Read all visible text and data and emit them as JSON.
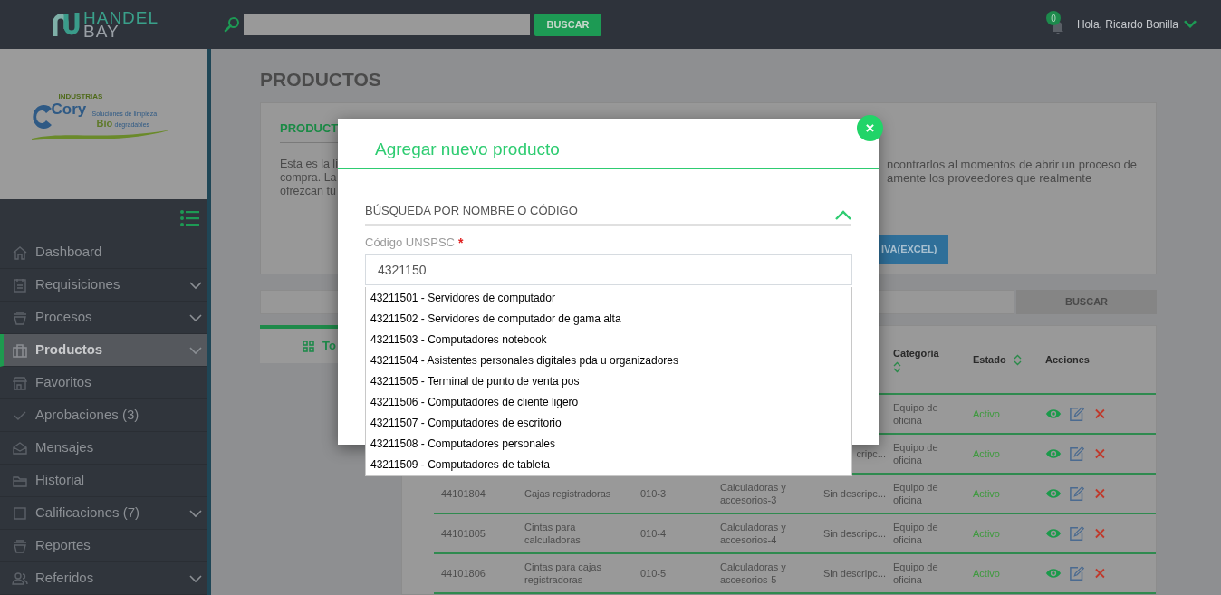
{
  "header": {
    "logo_top": "HANDEL",
    "logo_bottom": "BAY",
    "search_button": "BUSCAR",
    "notification_count": "0",
    "greeting": "Hola, Ricardo Bonilla"
  },
  "sidebar": {
    "company_logo": {
      "small": "INDUSTRIAS",
      "name": "Cory",
      "tagline": "Soluciones de limpieza",
      "bio": "Bio",
      "bio_rest": "degradables"
    },
    "items": [
      {
        "label": "Dashboard",
        "expandable": false,
        "selected": false
      },
      {
        "label": "Requisiciones",
        "expandable": true,
        "selected": false
      },
      {
        "label": "Procesos",
        "expandable": true,
        "selected": false
      },
      {
        "label": "Productos",
        "expandable": true,
        "selected": true
      },
      {
        "label": "Favoritos",
        "expandable": false,
        "selected": false
      },
      {
        "label": "Aprobaciones (3)",
        "expandable": false,
        "selected": false
      },
      {
        "label": "Mensajes",
        "expandable": false,
        "selected": false
      },
      {
        "label": "Historial",
        "expandable": false,
        "selected": false
      },
      {
        "label": "Calificaciones (7)",
        "expandable": true,
        "selected": false
      },
      {
        "label": "Reportes",
        "expandable": false,
        "selected": false
      },
      {
        "label": "Referidos",
        "expandable": true,
        "selected": false
      }
    ]
  },
  "main": {
    "title": "PRODUCTOS",
    "info_card": {
      "title": "PRODUCT",
      "text_left": [
        "Esta es la li",
        "compra. La",
        "ofrezcan tu"
      ],
      "text_right": [
        "ncontrarlos al momentos de abrir un proceso de",
        "amente los proveedores que realmente"
      ],
      "button": "IVA(EXCEL)"
    },
    "search_button": "BUSCAR",
    "tab": {
      "label": "To",
      "selected": true
    },
    "table": {
      "columns": [
        {
          "label": "Categoría",
          "sortable": true
        },
        {
          "label": "Estado",
          "sortable": true
        },
        {
          "label": "Acciones",
          "sortable": false
        }
      ],
      "rows": [
        {
          "category": "Equipo de oficina",
          "status": "Activo"
        },
        {
          "description": "cripc...",
          "category": "Equipo de oficina",
          "status": "Activo"
        },
        {
          "code": "44101804",
          "name": "Cajas registradoras",
          "reference": "010-3",
          "subcategory": "Calculadoras y accesorios-3",
          "description": "Sin descripc...",
          "category": "Equipo de oficina",
          "status": "Activo"
        },
        {
          "code": "44101805",
          "name": "Cintas para calculadoras",
          "reference": "010-4",
          "subcategory": "Calculadoras y accesorios-4",
          "description": "Sin descripc...",
          "category": "Equipo de oficina",
          "status": "Activo"
        },
        {
          "code": "44101806",
          "name": "Cintas para cajas registradoras",
          "reference": "010-5",
          "subcategory": "Calculadoras y accesorios-5",
          "description": "Sin descripc...",
          "category": "Equipo de oficina",
          "status": "Activo"
        }
      ]
    }
  },
  "modal": {
    "title": "Agregar nuevo producto",
    "close": "×",
    "section": {
      "title": "BÚSQUEDA POR NOMBRE O CÓDIGO",
      "expanded": true
    },
    "field": {
      "label": "Código UNSPSC",
      "required_mark": "*",
      "value": "4321150"
    },
    "suggestions": [
      "43211501 - Servidores de computador",
      "43211502 - Servidores de computador de gama alta",
      "43211503 - Computadores notebook",
      "43211504 - Asistentes personales digitales pda u organizadores",
      "43211505 - Terminal de punto de venta pos",
      "43211506 - Computadores de cliente ligero",
      "43211507 - Computadores de escritorio",
      "43211508 - Computadores personales",
      "43211509 - Computadores de tableta"
    ]
  }
}
